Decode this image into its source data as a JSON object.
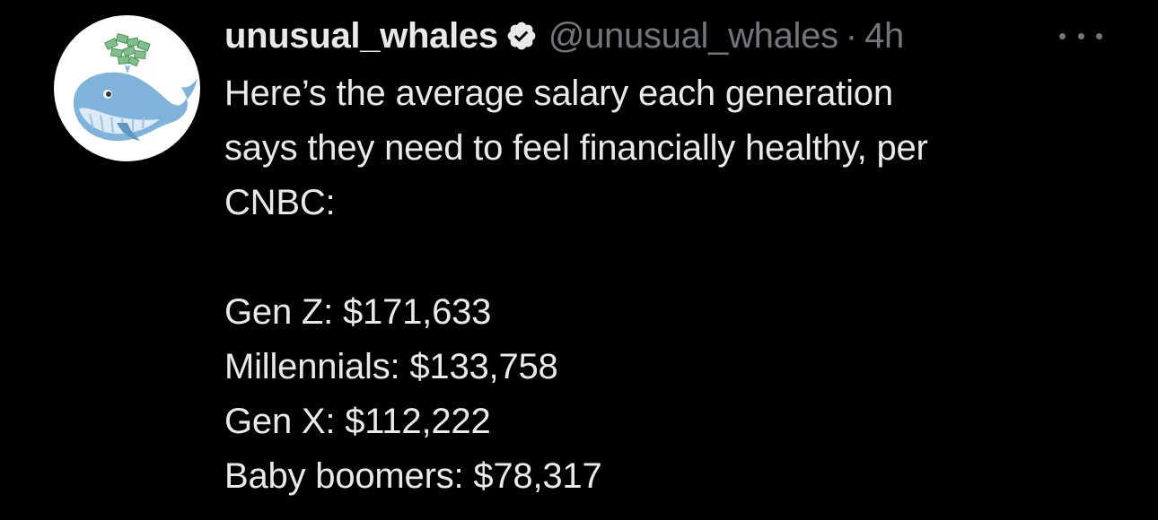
{
  "tweet": {
    "display_name": "unusual_whales",
    "handle": "@unusual_whales",
    "separator": "·",
    "time": "4h",
    "more_icon": "more-horizontal-icon",
    "verified_icon": "verified-badge-icon",
    "avatar_icon": "whale-with-money-icon",
    "text_lines": [
      "Here’s the average salary each generation",
      "says they need to feel financially healthy, per",
      "CNBC:"
    ],
    "list": [
      "Gen Z: $171,633",
      "Millennials: $133,758",
      "Gen X: $112,222",
      "Baby boomers: $78,317"
    ]
  },
  "colors": {
    "background": "#000000",
    "primary_text": "#e7e9ea",
    "secondary_text": "#71767b",
    "whale_blue": "#7fb3dc",
    "money_green": "#7fbf8a"
  }
}
